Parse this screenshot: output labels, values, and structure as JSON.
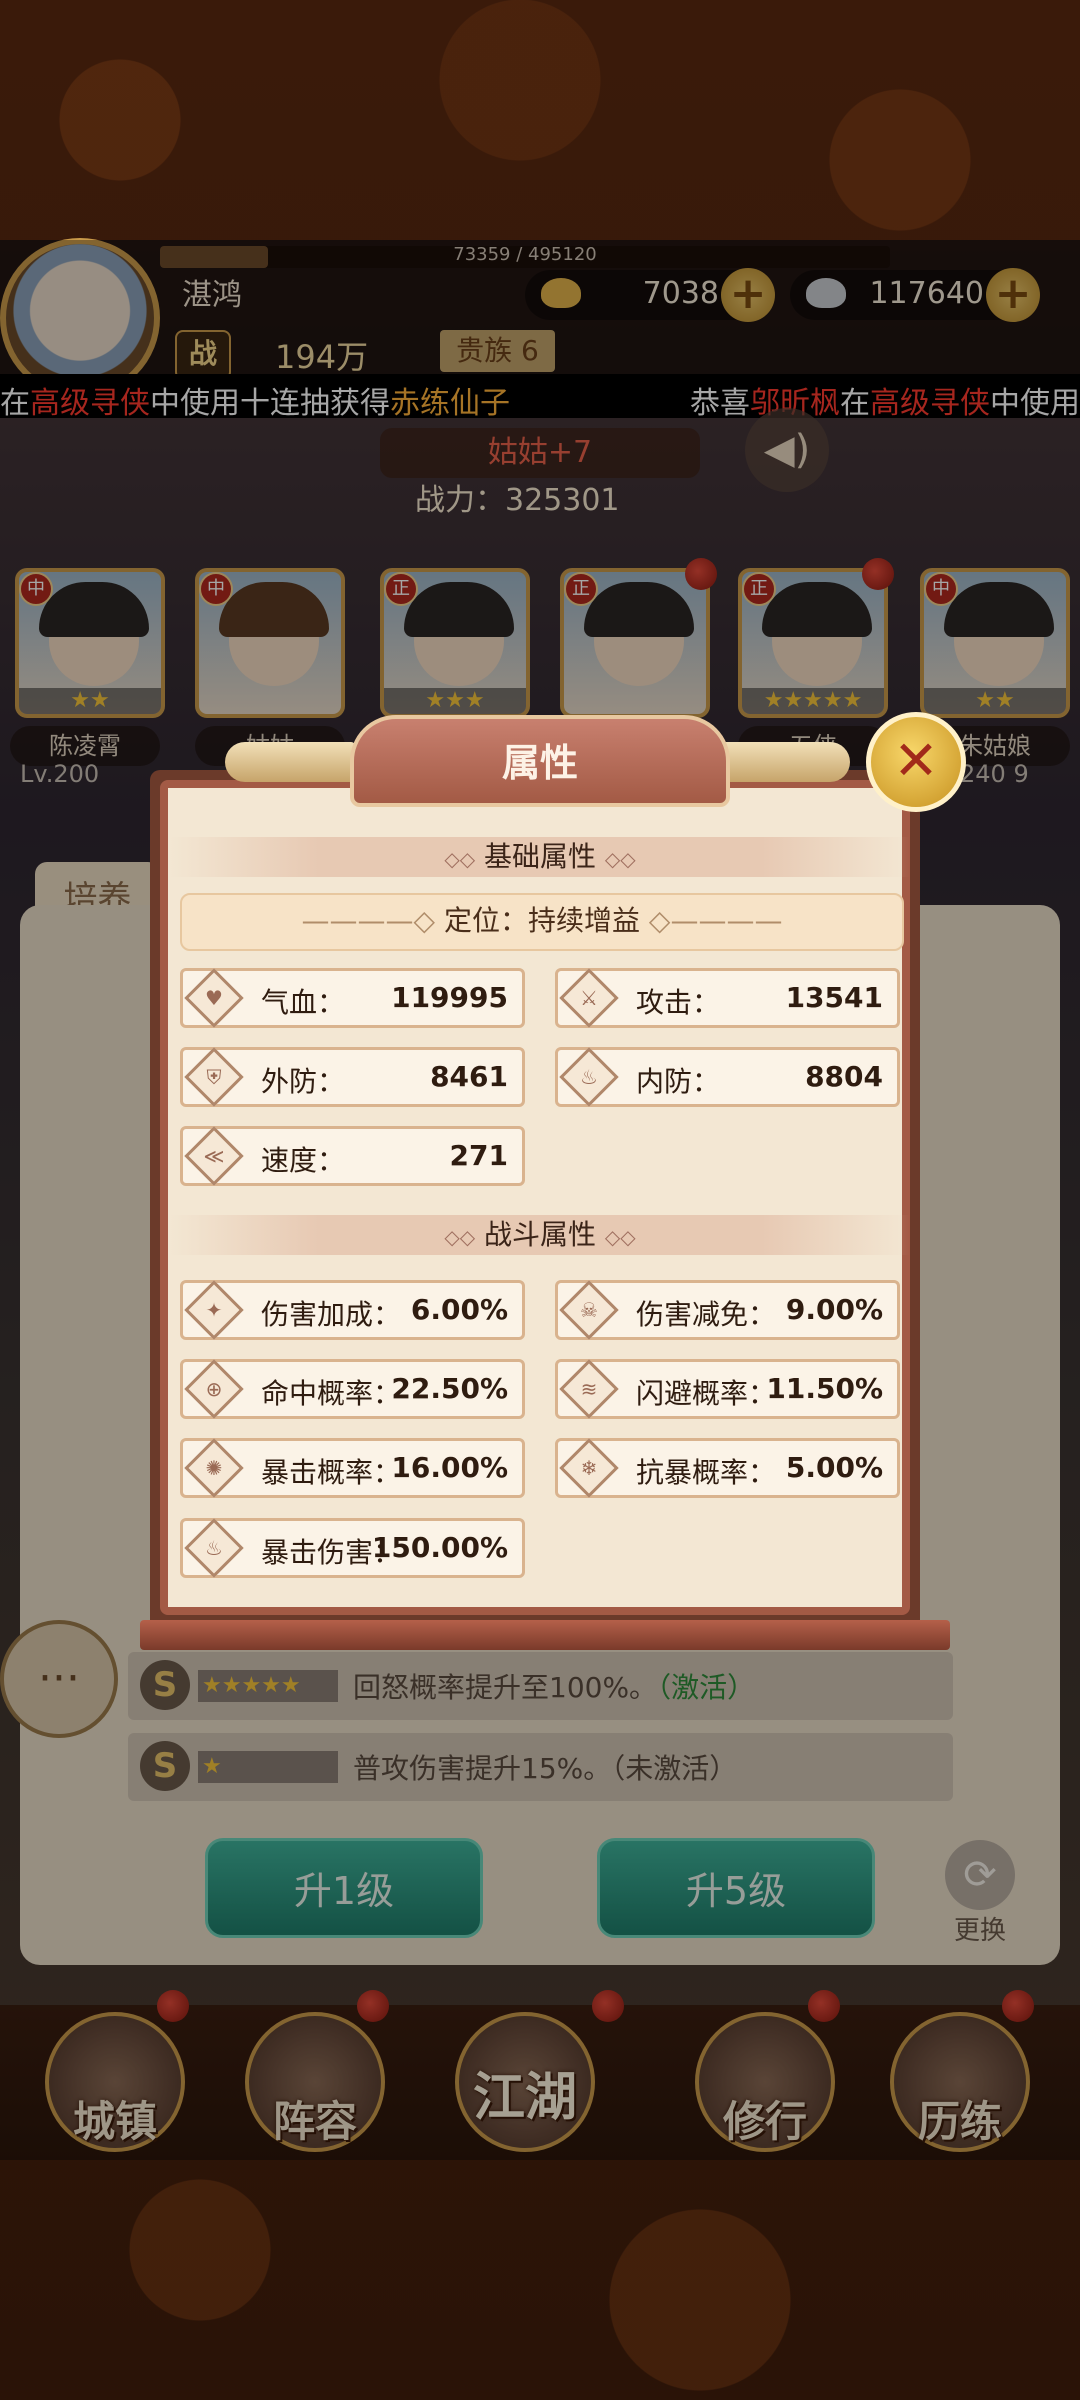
{
  "player": {
    "name": "湛鸿",
    "exp_text": "73359 / 495120",
    "exp_fraction": 0.148,
    "battle_badge": "战",
    "battle_power": "194万",
    "rank_label": "贵族 6"
  },
  "currencies": [
    {
      "name": "gold-ingot",
      "value": "7038"
    },
    {
      "name": "silver-ingot",
      "value": "117640"
    }
  ],
  "ticker": {
    "left": [
      {
        "text": "在",
        "color": "white"
      },
      {
        "text": "高级寻侠",
        "color": "red"
      },
      {
        "text": "中使用十连抽获得",
        "color": "white"
      },
      {
        "text": "赤练仙子",
        "color": "orange"
      }
    ],
    "right": [
      {
        "text": "恭喜",
        "color": "white"
      },
      {
        "text": "邬昕枫",
        "color": "red"
      },
      {
        "text": "在",
        "color": "white"
      },
      {
        "text": "高级寻侠",
        "color": "red"
      },
      {
        "text": "中使用",
        "color": "white"
      }
    ]
  },
  "hero_title": "姑姑+7",
  "combat_power": "战力：325301",
  "heroes": [
    {
      "role": "中",
      "name": "陈凌霄",
      "stars": "★★"
    },
    {
      "role": "中",
      "name": "姑姑",
      "stars": ""
    },
    {
      "role": "正",
      "name": "",
      "stars": "★★★"
    },
    {
      "role": "正",
      "name": "",
      "stars": ""
    },
    {
      "role": "正",
      "name": "五侠",
      "stars": "★★★★★"
    },
    {
      "role": "中",
      "name": "朱姑娘",
      "stars": "★★"
    }
  ],
  "levels": {
    "left": "Lv.200",
    "right": "240",
    "badge": "9"
  },
  "bg_tab": "培养",
  "skills": [
    {
      "stars": "★★★★★",
      "text": "回怒概率提升至100%。",
      "status": "（激活）"
    },
    {
      "stars": "★",
      "text": "普攻伤害提升15%。",
      "status": "（未激活）"
    }
  ],
  "buttons": {
    "up1": "升1级",
    "up5": "升5级",
    "swap": "更换"
  },
  "nav": [
    {
      "label": "城镇"
    },
    {
      "label": "阵容"
    },
    {
      "label": "江湖"
    },
    {
      "label": "修行"
    },
    {
      "label": "历练"
    }
  ],
  "modal": {
    "title": "属性",
    "basic_section": "基础属性",
    "position": "定位：持续增益",
    "basic_stats": [
      {
        "label": "气血：",
        "value": "119995",
        "icon": "heart-icon"
      },
      {
        "label": "攻击：",
        "value": "13541",
        "icon": "sword-icon"
      },
      {
        "label": "外防：",
        "value": "8461",
        "icon": "shield-icon"
      },
      {
        "label": "内防：",
        "value": "8804",
        "icon": "flame-icon"
      },
      {
        "label": "速度：",
        "value": "271",
        "icon": "wing-icon"
      }
    ],
    "combat_section": "战斗属性",
    "combat_stats": [
      {
        "label": "伤害加成：",
        "value": "6.00%",
        "icon": "damage-icon"
      },
      {
        "label": "伤害减免：",
        "value": "9.00%",
        "icon": "skull-icon"
      },
      {
        "label": "命中概率：",
        "value": "22.50%",
        "icon": "target-icon"
      },
      {
        "label": "闪避概率：",
        "value": "11.50%",
        "icon": "dodge-icon"
      },
      {
        "label": "暴击概率：",
        "value": "16.00%",
        "icon": "crit-icon"
      },
      {
        "label": "抗暴概率：",
        "value": "5.00%",
        "icon": "snowflake-icon"
      },
      {
        "label": "暴击伤害：",
        "value": "150.00%",
        "icon": "fire-icon"
      }
    ]
  }
}
